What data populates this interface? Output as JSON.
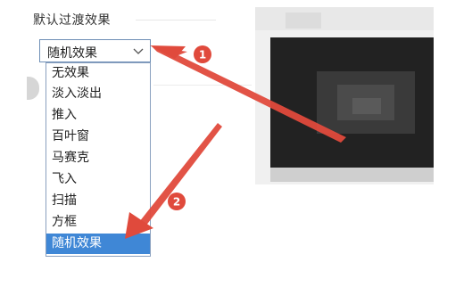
{
  "section": {
    "title": "默认过渡效果"
  },
  "transition_select": {
    "value": "随机效果",
    "options": [
      "无效果",
      "淡入淡出",
      "推入",
      "百叶窗",
      "马赛克",
      "飞入",
      "扫描",
      "方框",
      "随机效果"
    ],
    "selected_index": 8
  },
  "annotations": [
    {
      "number": "1"
    },
    {
      "number": "2"
    }
  ],
  "colors": {
    "highlight": "#3f87d6",
    "annotation_red": "#e04a3c"
  },
  "icons": {
    "caret": "chevron-down-icon"
  }
}
